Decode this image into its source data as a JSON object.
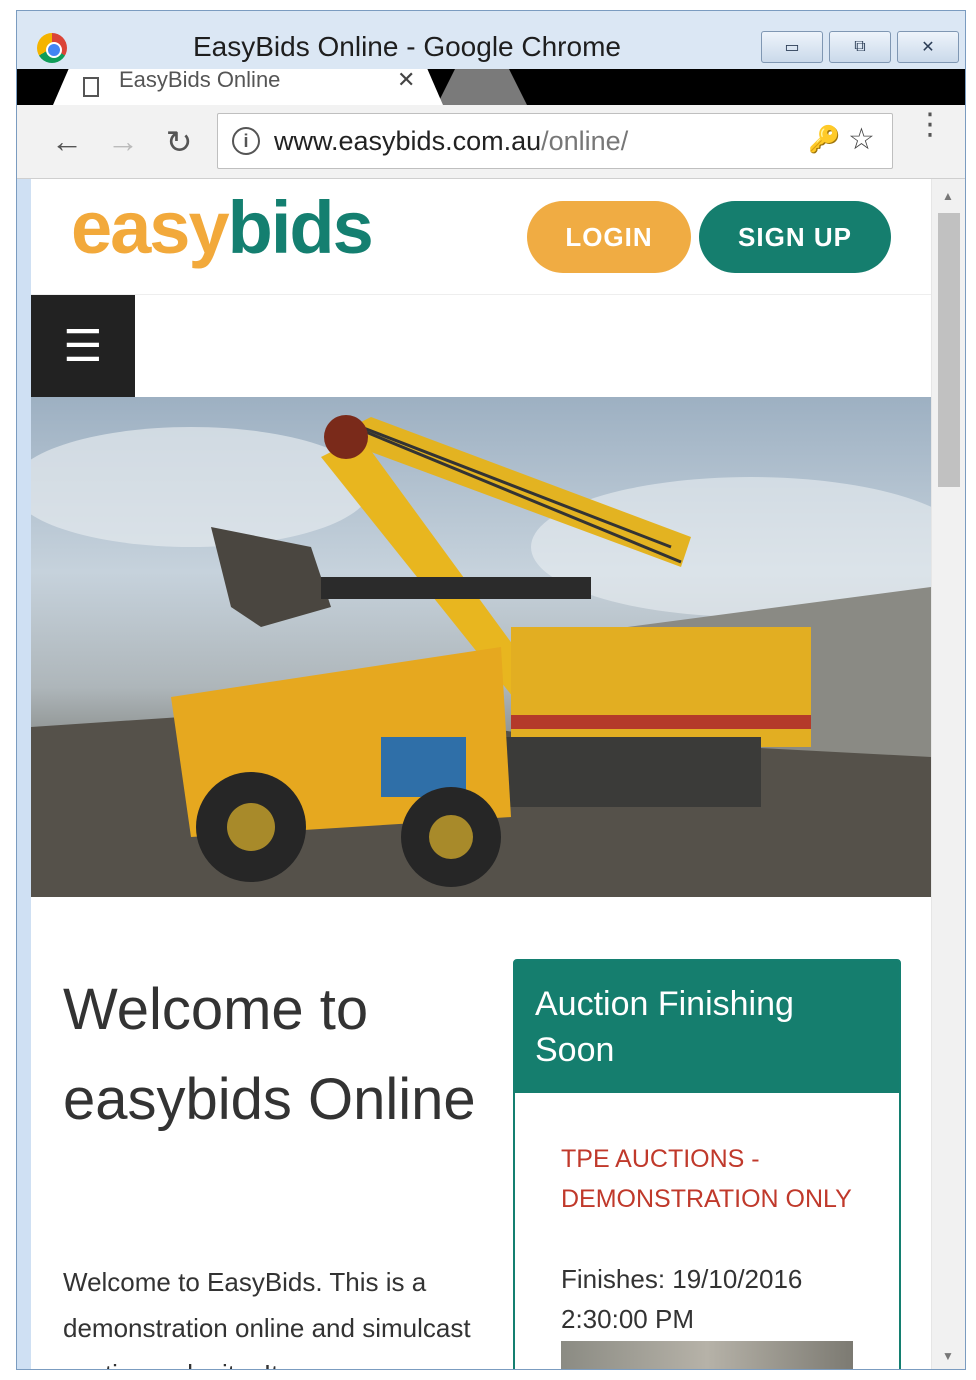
{
  "window": {
    "title": "EasyBids Online - Google Chrome",
    "minimize_glyph": "▭",
    "restore_glyph": "⧉",
    "close_glyph": "✕"
  },
  "tab": {
    "title": "EasyBids Online",
    "close_glyph": "✕"
  },
  "toolbar": {
    "back_glyph": "←",
    "forward_glyph": "→",
    "reload_glyph": "↻",
    "info_glyph": "i",
    "url_host": "www.easybids.com.au",
    "url_path": "/online/",
    "key_glyph": "🔑",
    "star_glyph": "☆",
    "menu_glyph": "⋮"
  },
  "site": {
    "logo_easy": "easy",
    "logo_bids": "bids",
    "login_label": "LOGIN",
    "signup_label": "SIGN UP",
    "menu_glyph": "☰",
    "welcome_title": "Welcome to easybids Online",
    "welcome_text": "Welcome to EasyBids.   This is a demonstration online and simulcast auction web site.   It"
  },
  "auction": {
    "heading": "Auction Finishing Soon",
    "name": "TPE AUCTIONS - DEMONSTRATION ONLY",
    "finishes": "Finishes: 19/10/2016 2:30:00 PM"
  },
  "colors": {
    "brand_orange": "#f0ac43",
    "brand_teal": "#157e6e",
    "auction_name_red": "#c0392b"
  }
}
